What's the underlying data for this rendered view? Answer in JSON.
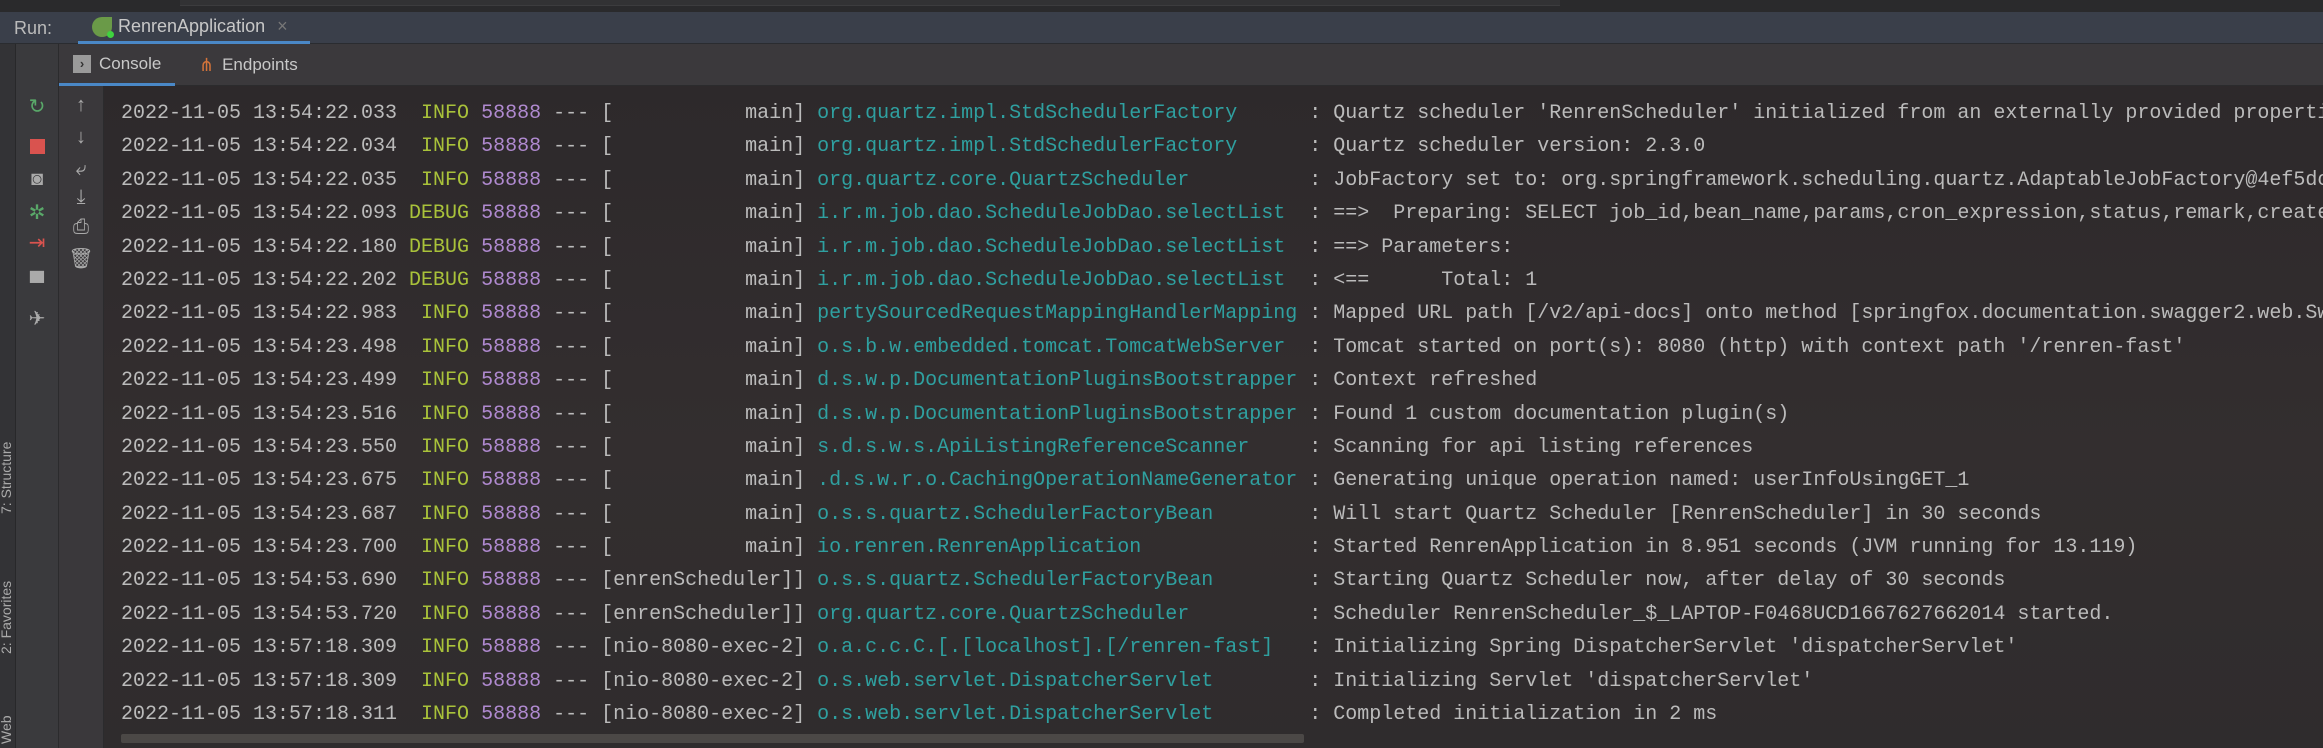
{
  "run_bar": {
    "label": "Run:",
    "tab_title": "RenrenApplication",
    "tab_icon": "spring-boot-icon",
    "close_icon": "close-icon"
  },
  "console_tabs": [
    {
      "label": "Console",
      "icon": "console-icon",
      "active": true
    },
    {
      "label": "Endpoints",
      "icon": "endpoints-icon",
      "active": false
    }
  ],
  "side_labels": [
    "7: Structure",
    "2: Favorites",
    "Web"
  ],
  "toolbar_left": [
    "rerun-icon",
    "stop-icon",
    "camera-icon",
    "debug-icon",
    "exit-icon",
    "layout-icon",
    "pin-icon"
  ],
  "toolbar_console": [
    "arrow-up-icon",
    "arrow-down-icon",
    "soft-wrap-icon",
    "scroll-to-end-icon",
    "print-icon",
    "trash-icon"
  ],
  "colors": {
    "level": "#a9c23a",
    "pid": "#b08ad0",
    "logger": "#2fa0a0",
    "text": "#bbbbbb",
    "accent": "#4a88c7"
  },
  "log_lines": [
    {
      "ts": "2022-11-05 13:54:22.033",
      "level": " INFO",
      "pid": "58888",
      "thread": "[           main]",
      "logger": "org.quartz.impl.StdSchedulerFactory     ",
      "msg": "Quartz scheduler 'RenrenScheduler' initialized from an externally provided properti"
    },
    {
      "ts": "2022-11-05 13:54:22.034",
      "level": " INFO",
      "pid": "58888",
      "thread": "[           main]",
      "logger": "org.quartz.impl.StdSchedulerFactory     ",
      "msg": "Quartz scheduler version: 2.3.0"
    },
    {
      "ts": "2022-11-05 13:54:22.035",
      "level": " INFO",
      "pid": "58888",
      "thread": "[           main]",
      "logger": "org.quartz.core.QuartzScheduler         ",
      "msg": "JobFactory set to: org.springframework.scheduling.quartz.AdaptableJobFactory@4ef5dc"
    },
    {
      "ts": "2022-11-05 13:54:22.093",
      "level": "DEBUG",
      "pid": "58888",
      "thread": "[           main]",
      "logger": "i.r.m.job.dao.ScheduleJobDao.selectList ",
      "msg": "==>  Preparing: SELECT job_id,bean_name,params,cron_expression,status,remark,create"
    },
    {
      "ts": "2022-11-05 13:54:22.180",
      "level": "DEBUG",
      "pid": "58888",
      "thread": "[           main]",
      "logger": "i.r.m.job.dao.ScheduleJobDao.selectList ",
      "msg": "==> Parameters: "
    },
    {
      "ts": "2022-11-05 13:54:22.202",
      "level": "DEBUG",
      "pid": "58888",
      "thread": "[           main]",
      "logger": "i.r.m.job.dao.ScheduleJobDao.selectList ",
      "msg": "<==      Total: 1"
    },
    {
      "ts": "2022-11-05 13:54:22.983",
      "level": " INFO",
      "pid": "58888",
      "thread": "[           main]",
      "logger": "pertySourcedRequestMappingHandlerMapping",
      "msg": "Mapped URL path [/v2/api-docs] onto method [springfox.documentation.swagger2.web.Sw"
    },
    {
      "ts": "2022-11-05 13:54:23.498",
      "level": " INFO",
      "pid": "58888",
      "thread": "[           main]",
      "logger": "o.s.b.w.embedded.tomcat.TomcatWebServer ",
      "msg": "Tomcat started on port(s): 8080 (http) with context path '/renren-fast'"
    },
    {
      "ts": "2022-11-05 13:54:23.499",
      "level": " INFO",
      "pid": "58888",
      "thread": "[           main]",
      "logger": "d.s.w.p.DocumentationPluginsBootstrapper",
      "msg": "Context refreshed"
    },
    {
      "ts": "2022-11-05 13:54:23.516",
      "level": " INFO",
      "pid": "58888",
      "thread": "[           main]",
      "logger": "d.s.w.p.DocumentationPluginsBootstrapper",
      "msg": "Found 1 custom documentation plugin(s)"
    },
    {
      "ts": "2022-11-05 13:54:23.550",
      "level": " INFO",
      "pid": "58888",
      "thread": "[           main]",
      "logger": "s.d.s.w.s.ApiListingReferenceScanner    ",
      "msg": "Scanning for api listing references"
    },
    {
      "ts": "2022-11-05 13:54:23.675",
      "level": " INFO",
      "pid": "58888",
      "thread": "[           main]",
      "logger": ".d.s.w.r.o.CachingOperationNameGenerator",
      "msg": "Generating unique operation named: userInfoUsingGET_1"
    },
    {
      "ts": "2022-11-05 13:54:23.687",
      "level": " INFO",
      "pid": "58888",
      "thread": "[           main]",
      "logger": "o.s.s.quartz.SchedulerFactoryBean       ",
      "msg": "Will start Quartz Scheduler [RenrenScheduler] in 30 seconds"
    },
    {
      "ts": "2022-11-05 13:54:23.700",
      "level": " INFO",
      "pid": "58888",
      "thread": "[           main]",
      "logger": "io.renren.RenrenApplication             ",
      "msg": "Started RenrenApplication in 8.951 seconds (JVM running for 13.119)"
    },
    {
      "ts": "2022-11-05 13:54:53.690",
      "level": " INFO",
      "pid": "58888",
      "thread": "[enrenScheduler]]",
      "logger": "o.s.s.quartz.SchedulerFactoryBean       ",
      "msg": "Starting Quartz Scheduler now, after delay of 30 seconds"
    },
    {
      "ts": "2022-11-05 13:54:53.720",
      "level": " INFO",
      "pid": "58888",
      "thread": "[enrenScheduler]]",
      "logger": "org.quartz.core.QuartzScheduler         ",
      "msg": "Scheduler RenrenScheduler_$_LAPTOP-F0468UCD1667627662014 started."
    },
    {
      "ts": "2022-11-05 13:57:18.309",
      "level": " INFO",
      "pid": "58888",
      "thread": "[nio-8080-exec-2]",
      "logger": "o.a.c.c.C.[.[localhost].[/renren-fast]  ",
      "msg": "Initializing Spring DispatcherServlet 'dispatcherServlet'"
    },
    {
      "ts": "2022-11-05 13:57:18.309",
      "level": " INFO",
      "pid": "58888",
      "thread": "[nio-8080-exec-2]",
      "logger": "o.s.web.servlet.DispatcherServlet       ",
      "msg": "Initializing Servlet 'dispatcherServlet'"
    },
    {
      "ts": "2022-11-05 13:57:18.311",
      "level": " INFO",
      "pid": "58888",
      "thread": "[nio-8080-exec-2]",
      "logger": "o.s.web.servlet.DispatcherServlet       ",
      "msg": "Completed initialization in 2 ms"
    }
  ]
}
